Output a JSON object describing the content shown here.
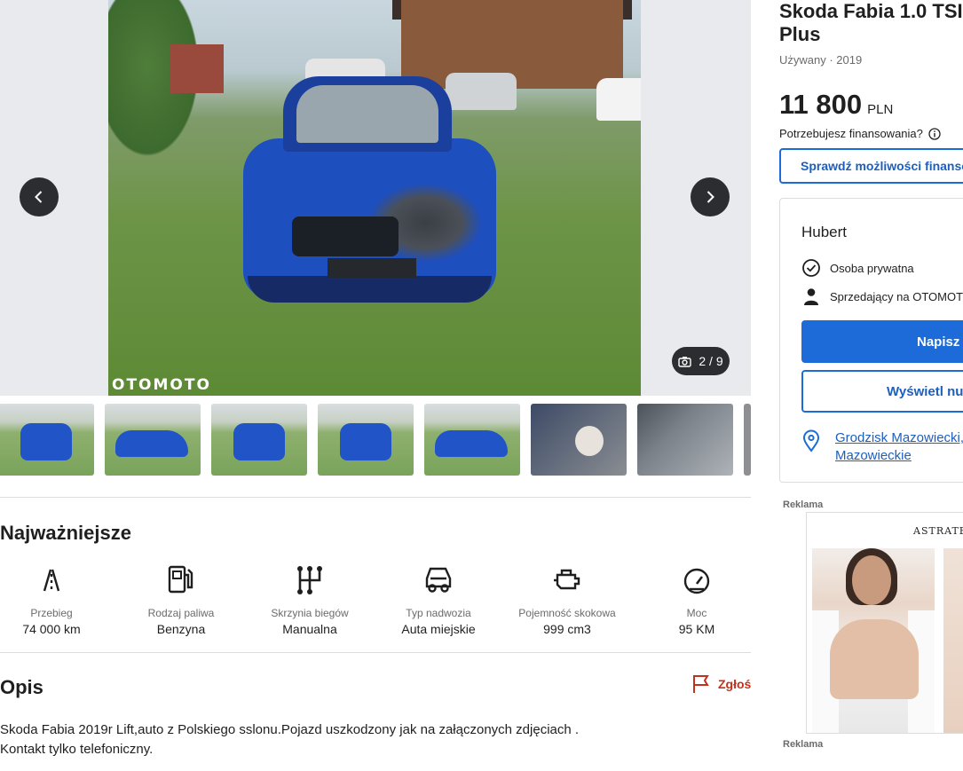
{
  "gallery": {
    "watermark": "OTOMOTO",
    "counter": "2 / 9",
    "prev_icon": "chevron-left-icon",
    "next_icon": "chevron-right-icon",
    "camera_icon": "camera-icon",
    "thumbnails": [
      {
        "kind": "front"
      },
      {
        "kind": "front-left"
      },
      {
        "kind": "rear"
      },
      {
        "kind": "rear"
      },
      {
        "kind": "side"
      },
      {
        "kind": "interior"
      },
      {
        "kind": "engine"
      },
      {
        "kind": "partial"
      }
    ]
  },
  "listing": {
    "title_line1": "Skoda Fabia 1.0 TSI",
    "title_line2": "Plus",
    "subtitle": "Używany · 2019",
    "price": "11 800",
    "currency": "PLN",
    "finance_question": "Potrzebujesz finansowania?",
    "finance_button": "Sprawdź możliwości finansowania"
  },
  "seller": {
    "name": "Hubert",
    "type": "Osoba prywatna",
    "member": "Sprzedający na OTOMOTO od",
    "message_button": "Napisz",
    "phone_button": "Wyświetl numer",
    "location_line1": "Grodzisk Mazowiecki,",
    "location_line2": "Mazowieckie"
  },
  "ads": {
    "label": "Reklama",
    "label_bottom": "Reklama",
    "brand": "ASTRATEX"
  },
  "highlights": {
    "heading": "Najważniejsze",
    "items": [
      {
        "label": "Przebieg",
        "value": "74 000 km",
        "icon": "road-icon"
      },
      {
        "label": "Rodzaj paliwa",
        "value": "Benzyna",
        "icon": "fuel-pump-icon"
      },
      {
        "label": "Skrzynia biegów",
        "value": "Manualna",
        "icon": "gearbox-icon"
      },
      {
        "label": "Typ nadwozia",
        "value": "Auta miejskie",
        "icon": "car-body-icon"
      },
      {
        "label": "Pojemność skokowa",
        "value": "999 cm3",
        "icon": "engine-icon"
      },
      {
        "label": "Moc",
        "value": "95 KM",
        "icon": "speedometer-icon"
      }
    ]
  },
  "description": {
    "heading": "Opis",
    "report": "Zgłoś",
    "line1": "Skoda Fabia 2019r Lift,auto z Polskiego sslonu.Pojazd uszkodzony jak na załączonych zdjęciach .",
    "line2": "Kontakt tylko telefoniczny."
  },
  "colors": {
    "accent": "#1d6bd8",
    "report": "#c2311b"
  }
}
